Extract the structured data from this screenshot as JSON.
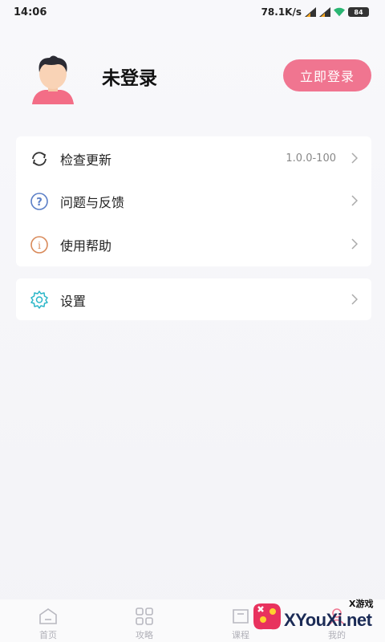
{
  "status_bar": {
    "time": "14:06",
    "network_speed": "78.1K/s",
    "battery": "84"
  },
  "profile": {
    "username": "未登录",
    "login_button": "立即登录"
  },
  "menu_card": {
    "items": [
      {
        "label": "检查更新",
        "value": "1.0.0-100",
        "icon": "refresh-icon"
      },
      {
        "label": "问题与反馈",
        "value": "",
        "icon": "question-icon"
      },
      {
        "label": "使用帮助",
        "value": "",
        "icon": "info-icon"
      }
    ]
  },
  "settings_card": {
    "items": [
      {
        "label": "设置",
        "icon": "gear-icon"
      }
    ]
  },
  "tab_bar": {
    "tabs": [
      {
        "label": "首页",
        "icon": "home-icon"
      },
      {
        "label": "攻略",
        "icon": "grid-icon"
      },
      {
        "label": "课程",
        "icon": "book-icon"
      },
      {
        "label": "我的",
        "icon": "user-icon"
      }
    ]
  },
  "watermark": {
    "site": "XYouXi.net",
    "small": "X游戏"
  },
  "colors": {
    "accent": "#f07590",
    "refresh_icon": "#333333",
    "question_icon": "#5b7fc7",
    "info_icon": "#d98a5a",
    "gear_icon": "#2ab6c8"
  }
}
